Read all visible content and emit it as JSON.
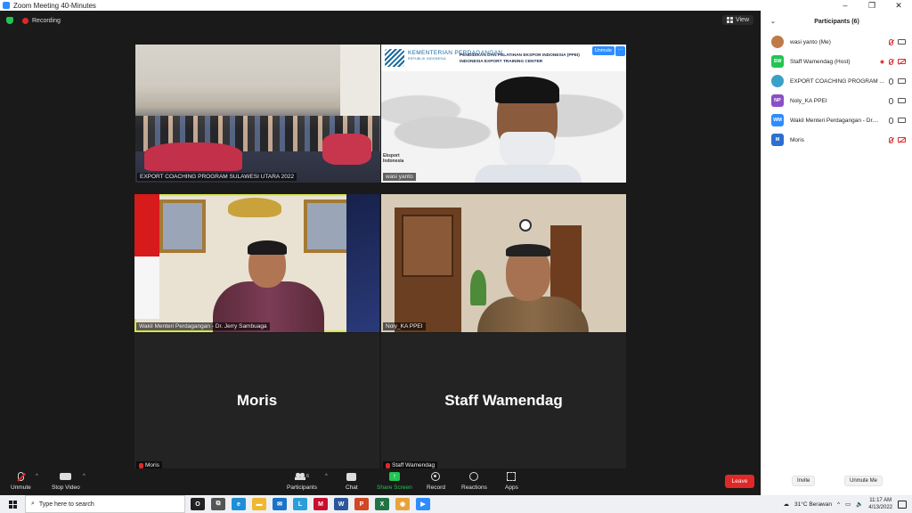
{
  "window": {
    "title": "Zoom Meeting 40-Minutes",
    "controls": [
      "–",
      "❐",
      "✕"
    ]
  },
  "topbar": {
    "recording_label": "Recording",
    "view_label": "View"
  },
  "tiles": [
    {
      "name": "EXPORT COACHING PROGRAM SULAWESI UTARA 2022"
    },
    {
      "name": "wasi yanto",
      "logo_title": "KEMENTERIAN PERDAGANGAN",
      "logo_subtitle": "REPUBLIK INDONESIA",
      "center_line1": "PENDIDIKAN DAN PELATIHAN EKSPOR INDONESIA (PPEI)",
      "center_line2": "INDONESIA EXPORT TRAINING CENTER",
      "side_text_1": "Eksport",
      "side_text_2": "Indonesia",
      "unmute_label": "Unmute",
      "more_label": "···"
    },
    {
      "name": "Wakil Menteri Perdagangan - Dr. Jerry Sambuaga"
    },
    {
      "name": "Noly_KA PPEI"
    },
    {
      "name": "Moris",
      "big_name": "Moris"
    },
    {
      "name": "Staff Wamendag",
      "big_name": "Staff Wamendag"
    }
  ],
  "toolbar": {
    "unmute": "Unmute",
    "stop_video": "Stop Video",
    "participants": "Participants",
    "participants_count": "6",
    "chat": "Chat",
    "share_screen": "Share Screen",
    "record": "Record",
    "reactions": "Reactions",
    "apps": "Apps",
    "leave": "Leave"
  },
  "panel": {
    "title": "Participants (6)",
    "participants": [
      {
        "name": "wasi yanto (Me)",
        "initials": "",
        "color": "#c07a4a"
      },
      {
        "name": "Staff Wamendag (Host)",
        "initials": "SW",
        "color": "#23c552"
      },
      {
        "name": "EXPORT COACHING PROGRAM ...",
        "initials": "",
        "color": "#3aa0c8"
      },
      {
        "name": "Noly_KA PPEI",
        "initials": "NP",
        "color": "#8a4fc7"
      },
      {
        "name": "Wakil Menteri Perdagangan - Dr....",
        "initials": "WM",
        "color": "#2d8cff"
      },
      {
        "name": "Moris",
        "initials": "M",
        "color": "#2d6fd0"
      }
    ],
    "invite": "Invite",
    "unmute_me": "Unmute Me"
  },
  "taskbar": {
    "search_placeholder": "Type here to search",
    "weather": "31°C  Berawan",
    "time": "11:17 AM",
    "date": "4/13/2022",
    "apps": [
      {
        "name": "cortana-icon",
        "color": "#222222",
        "label": "O"
      },
      {
        "name": "task-view-icon",
        "color": "#555555",
        "label": "⧉"
      },
      {
        "name": "edge-icon",
        "color": "#1e8fd6",
        "label": "e"
      },
      {
        "name": "file-explorer-icon",
        "color": "#f0b732",
        "label": "▬"
      },
      {
        "name": "mail-icon",
        "color": "#1a73c8",
        "label": "✉"
      },
      {
        "name": "l-app-icon",
        "color": "#2b9ed8",
        "label": "L"
      },
      {
        "name": "mcafee-icon",
        "color": "#c8102e",
        "label": "M"
      },
      {
        "name": "word-icon",
        "color": "#2b579a",
        "label": "W"
      },
      {
        "name": "powerpoint-icon",
        "color": "#d24726",
        "label": "P"
      },
      {
        "name": "excel-icon",
        "color": "#217346",
        "label": "X"
      },
      {
        "name": "chrome-icon",
        "color": "#e8a33b",
        "label": "◉"
      },
      {
        "name": "zoom-icon",
        "color": "#2d8cff",
        "label": "▶"
      }
    ]
  }
}
